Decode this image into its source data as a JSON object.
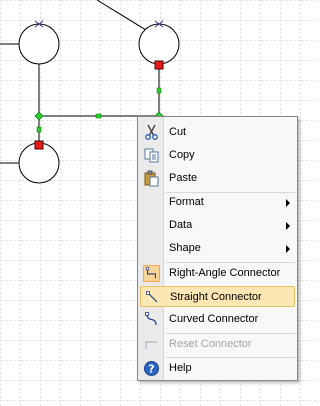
{
  "context_menu": {
    "items": [
      {
        "label": "Cut",
        "icon": "scissors-icon",
        "enabled": true
      },
      {
        "label": "Copy",
        "icon": "copy-icon",
        "enabled": true
      },
      {
        "label": "Paste",
        "icon": "paste-icon",
        "enabled": true
      },
      {
        "label": "Format",
        "submenu": true,
        "enabled": true
      },
      {
        "label": "Data",
        "submenu": true,
        "enabled": true
      },
      {
        "label": "Shape",
        "submenu": true,
        "enabled": true
      },
      {
        "label": "Right-Angle Connector",
        "icon": "right-angle-connector-icon",
        "checked": true,
        "enabled": true
      },
      {
        "label": "Straight Connector",
        "icon": "straight-connector-icon",
        "highlighted": true,
        "enabled": true
      },
      {
        "label": "Curved Connector",
        "icon": "curved-connector-icon",
        "enabled": true
      },
      {
        "label": "Reset Connector",
        "icon": "reset-connector-icon",
        "enabled": false
      },
      {
        "label": "Help",
        "icon": "help-icon",
        "enabled": true
      }
    ]
  },
  "colors": {
    "grid": "#c6c6c6",
    "handle_green": "#2ecc2e",
    "handle_red": "#e31b1b",
    "menu_highlight": "#fce7b4",
    "menu_checked": "#fad595"
  }
}
